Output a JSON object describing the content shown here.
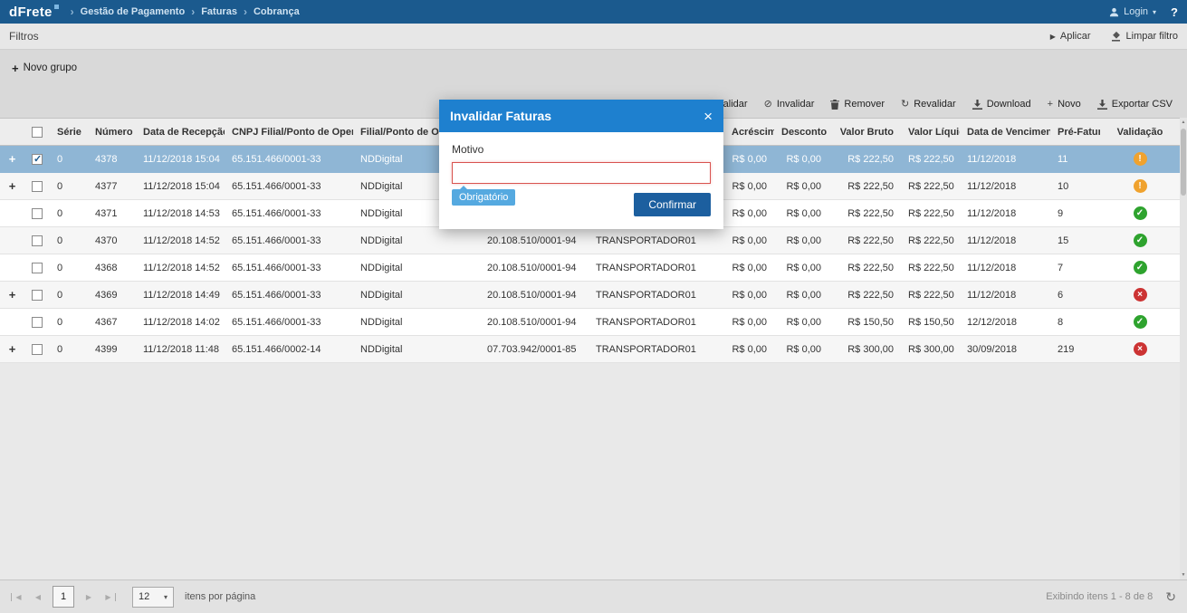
{
  "colors": {
    "navbar": "#1b5a8e",
    "modal_header": "#1e80cf",
    "confirm_button": "#1c5f9f",
    "selected_row": "#8fb6d5",
    "required_badge": "#55a9e0",
    "status": {
      "warning": "#f0a22e",
      "valid": "#2ea32e",
      "invalid": "#cc3333"
    }
  },
  "navbar": {
    "logo": "dFrete",
    "breadcrumb": [
      "Gestão de Pagamento",
      "Faturas",
      "Cobrança"
    ],
    "login_label": "Login",
    "help": "?"
  },
  "filters": {
    "title": "Filtros",
    "apply_label": "Aplicar",
    "clear_label": "Limpar filtro"
  },
  "groups": {
    "new_group_label": "Novo grupo"
  },
  "toolbar": {
    "actions": [
      {
        "label": "Validar",
        "icon": "validate-icon"
      },
      {
        "label": "Invalidar",
        "icon": "invalidate-icon"
      },
      {
        "label": "Remover",
        "icon": "remove-icon"
      },
      {
        "label": "Revalidar",
        "icon": "revalidate-icon"
      },
      {
        "label": "Download",
        "icon": "download-icon"
      },
      {
        "label": "Novo",
        "icon": "new-icon"
      },
      {
        "label": "Exportar CSV",
        "icon": "export-csv-icon"
      }
    ]
  },
  "table": {
    "sort_column": "Data de Recepção",
    "columns": [
      "Série",
      "Número",
      "Data de Recepção",
      "CNPJ Filial/Ponto de Operação",
      "Filial/Ponto de Operação",
      "",
      "",
      "Acréscimo",
      "Desconto",
      "Valor Bruto",
      "Valor Líquido",
      "Data de Vencimento",
      "Pré-Fatura",
      "Validação"
    ],
    "rows": [
      {
        "expand": true,
        "checked": true,
        "selected": true,
        "status": "warning",
        "cells": [
          "0",
          "4378",
          "11/12/2018 15:04",
          "65.151.466/0001-33",
          "NDDigital",
          "",
          "",
          "R$ 0,00",
          "R$ 0,00",
          "R$ 222,50",
          "R$ 222,50",
          "11/12/2018",
          "11"
        ]
      },
      {
        "expand": true,
        "checked": false,
        "selected": false,
        "status": "warning",
        "cells": [
          "0",
          "4377",
          "11/12/2018 15:04",
          "65.151.466/0001-33",
          "NDDigital",
          "",
          "",
          "R$ 0,00",
          "R$ 0,00",
          "R$ 222,50",
          "R$ 222,50",
          "11/12/2018",
          "10"
        ]
      },
      {
        "expand": false,
        "checked": false,
        "selected": false,
        "status": "valid",
        "cells": [
          "0",
          "4371",
          "11/12/2018 14:53",
          "65.151.466/0001-33",
          "NDDigital",
          "",
          "",
          "R$ 0,00",
          "R$ 0,00",
          "R$ 222,50",
          "R$ 222,50",
          "11/12/2018",
          "9"
        ]
      },
      {
        "expand": false,
        "checked": false,
        "selected": false,
        "status": "valid",
        "cells": [
          "0",
          "4370",
          "11/12/2018 14:52",
          "65.151.466/0001-33",
          "NDDigital",
          "20.108.510/0001-94",
          "TRANSPORTADOR01",
          "R$ 0,00",
          "R$ 0,00",
          "R$ 222,50",
          "R$ 222,50",
          "11/12/2018",
          "15"
        ]
      },
      {
        "expand": false,
        "checked": false,
        "selected": false,
        "status": "valid",
        "cells": [
          "0",
          "4368",
          "11/12/2018 14:52",
          "65.151.466/0001-33",
          "NDDigital",
          "20.108.510/0001-94",
          "TRANSPORTADOR01",
          "R$ 0,00",
          "R$ 0,00",
          "R$ 222,50",
          "R$ 222,50",
          "11/12/2018",
          "7"
        ]
      },
      {
        "expand": true,
        "checked": false,
        "selected": false,
        "status": "invalid",
        "cells": [
          "0",
          "4369",
          "11/12/2018 14:49",
          "65.151.466/0001-33",
          "NDDigital",
          "20.108.510/0001-94",
          "TRANSPORTADOR01",
          "R$ 0,00",
          "R$ 0,00",
          "R$ 222,50",
          "R$ 222,50",
          "11/12/2018",
          "6"
        ]
      },
      {
        "expand": false,
        "checked": false,
        "selected": false,
        "status": "valid",
        "cells": [
          "0",
          "4367",
          "11/12/2018 14:02",
          "65.151.466/0001-33",
          "NDDigital",
          "20.108.510/0001-94",
          "TRANSPORTADOR01",
          "R$ 0,00",
          "R$ 0,00",
          "R$ 150,50",
          "R$ 150,50",
          "12/12/2018",
          "8"
        ]
      },
      {
        "expand": true,
        "checked": false,
        "selected": false,
        "status": "invalid",
        "cells": [
          "0",
          "4399",
          "11/12/2018 11:48",
          "65.151.466/0002-14",
          "NDDigital",
          "07.703.942/0001-85",
          "TRANSPORTADOR01",
          "R$ 0,00",
          "R$ 0,00",
          "R$ 300,00",
          "R$ 300,00",
          "30/09/2018",
          "219"
        ]
      }
    ]
  },
  "modal": {
    "title": "Invalidar Faturas",
    "close": "×",
    "motivo_label": "Motivo",
    "motivo_value": "",
    "required_badge": "Obrigatório",
    "confirm_label": "Confirmar"
  },
  "pagination": {
    "current_page": "1",
    "page_size": "12",
    "items_per_page_label": "itens por página",
    "status_text": "Exibindo itens 1 - 8 de 8"
  }
}
